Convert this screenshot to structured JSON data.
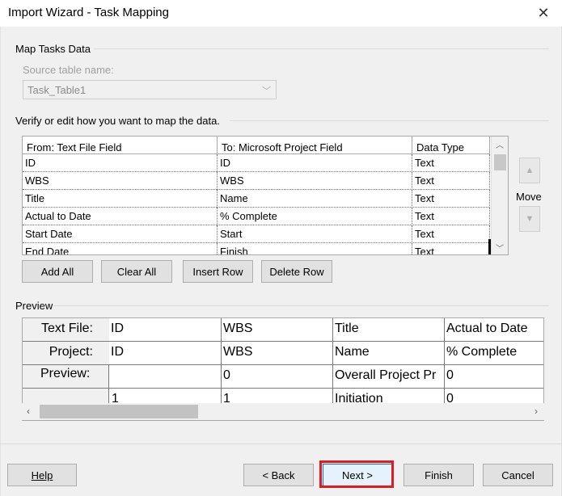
{
  "window": {
    "title": "Import Wizard - Task Mapping",
    "close_glyph": "✕"
  },
  "map_group": {
    "title": "Map Tasks Data"
  },
  "source": {
    "label": "Source table name:",
    "value": "Task_Table1"
  },
  "verify_text": "Verify or edit how you want to map the data.",
  "mapping": {
    "columns": [
      "From: Text File Field",
      "To:  Microsoft Project Field",
      "Data Type"
    ],
    "rows": [
      [
        "ID",
        "ID",
        "Text"
      ],
      [
        "WBS",
        "WBS",
        "Text"
      ],
      [
        "Title",
        "Name",
        "Text"
      ],
      [
        "Actual to Date",
        "% Complete",
        "Text"
      ],
      [
        "Start Date",
        "Start",
        "Text"
      ],
      [
        "End Date",
        "Finish",
        "Text"
      ]
    ]
  },
  "move": {
    "label": "Move"
  },
  "row_buttons": {
    "add_all": "Add All",
    "clear_all": "Clear All",
    "insert_row": "Insert Row",
    "delete_row": "Delete Row"
  },
  "preview": {
    "title": "Preview",
    "text_file_label": "Text File:",
    "project_label": "Project:",
    "preview_label": "Preview:",
    "text_file_row": [
      "ID",
      "WBS",
      "Title",
      "Actual to Date"
    ],
    "project_row": [
      "ID",
      "WBS",
      "Name",
      "% Complete"
    ],
    "data_rows": [
      [
        "",
        "0",
        "Overall Project Pr",
        "0"
      ],
      [
        "1",
        "1",
        "Initiation",
        "0"
      ]
    ]
  },
  "footer": {
    "help": "Help",
    "back": "< Back",
    "next": "Next >",
    "finish": "Finish",
    "cancel": "Cancel"
  },
  "colors": {
    "highlight": "#e11b22"
  }
}
